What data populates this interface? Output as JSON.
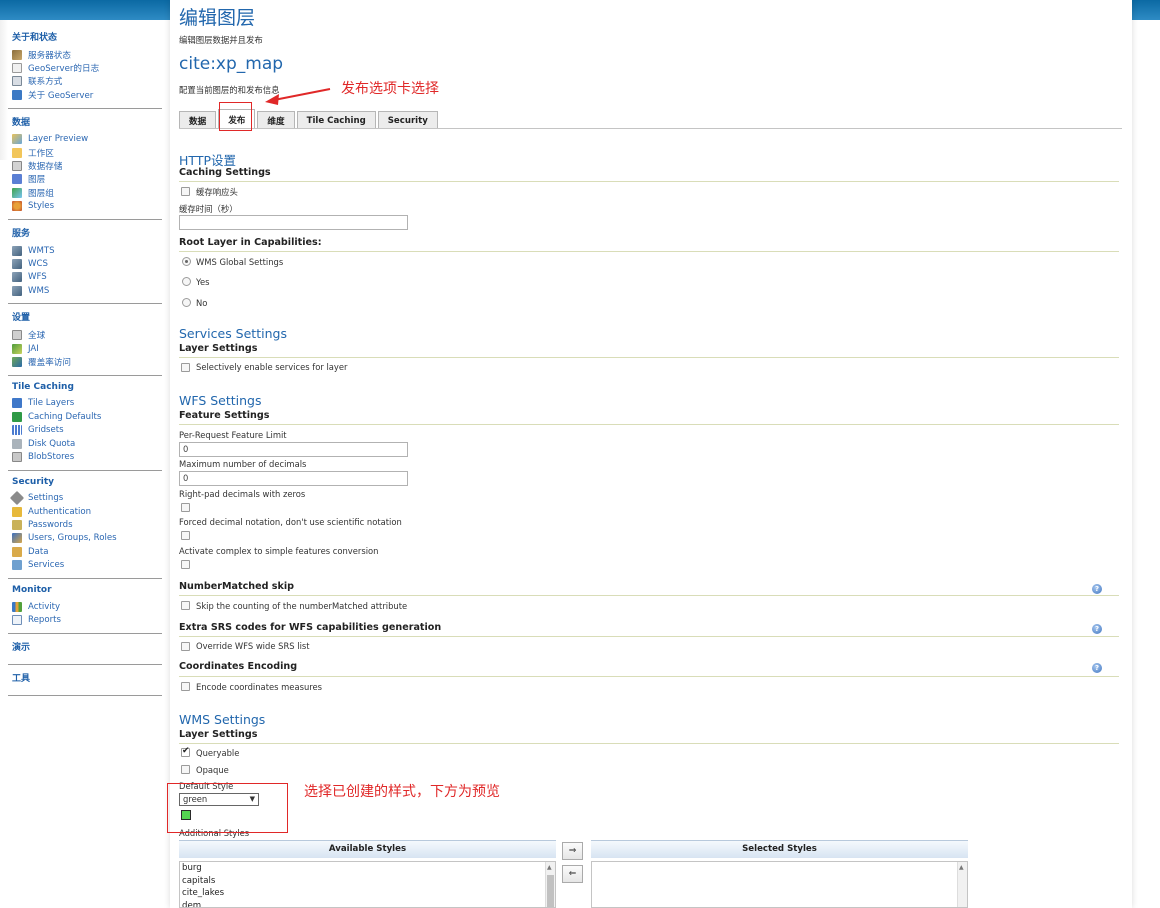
{
  "sidebar": {
    "sections": [
      {
        "title": "关于和状态",
        "items": [
          {
            "label": "服务器状态",
            "icon": "people-icon"
          },
          {
            "label": "GeoServer的日志",
            "icon": "doc-icon"
          },
          {
            "label": "联系方式",
            "icon": "card-icon"
          },
          {
            "label": "关于 GeoServer",
            "icon": "info-icon"
          }
        ]
      },
      {
        "title": "数据",
        "items": [
          {
            "label": "Layer Preview",
            "icon": "layer-preview-icon"
          },
          {
            "label": "工作区",
            "icon": "folder-icon"
          },
          {
            "label": "数据存储",
            "icon": "database-icon"
          },
          {
            "label": "图层",
            "icon": "layer-icon"
          },
          {
            "label": "图层组",
            "icon": "layergroup-icon"
          },
          {
            "label": "Styles",
            "icon": "styles-icon"
          }
        ]
      },
      {
        "title": "服务",
        "items": [
          {
            "label": "WMTS",
            "icon": "service-icon"
          },
          {
            "label": "WCS",
            "icon": "service-icon"
          },
          {
            "label": "WFS",
            "icon": "service-icon"
          },
          {
            "label": "WMS",
            "icon": "service-icon"
          }
        ]
      },
      {
        "title": "设置",
        "items": [
          {
            "label": "全球",
            "icon": "global-icon"
          },
          {
            "label": "JAI",
            "icon": "jai-icon"
          },
          {
            "label": "覆盖率访问",
            "icon": "coverage-icon"
          }
        ]
      },
      {
        "title": "Tile Caching",
        "items": [
          {
            "label": "Tile Layers",
            "icon": "tile-layers-icon"
          },
          {
            "label": "Caching Defaults",
            "icon": "caching-defaults-icon"
          },
          {
            "label": "Gridsets",
            "icon": "gridsets-icon"
          },
          {
            "label": "Disk Quota",
            "icon": "disk-quota-icon"
          },
          {
            "label": "BlobStores",
            "icon": "blobstores-icon"
          }
        ]
      },
      {
        "title": "Security",
        "items": [
          {
            "label": "Settings",
            "icon": "settings-icon"
          },
          {
            "label": "Authentication",
            "icon": "authentication-icon"
          },
          {
            "label": "Passwords",
            "icon": "passwords-icon"
          },
          {
            "label": "Users, Groups, Roles",
            "icon": "users-icon"
          },
          {
            "label": "Data",
            "icon": "data-icon"
          },
          {
            "label": "Services",
            "icon": "services-icon"
          }
        ]
      },
      {
        "title": "Monitor",
        "items": [
          {
            "label": "Activity",
            "icon": "activity-icon"
          },
          {
            "label": "Reports",
            "icon": "reports-icon"
          }
        ]
      },
      {
        "title": "演示",
        "items": []
      },
      {
        "title": "工具",
        "items": []
      }
    ]
  },
  "header": {
    "title": "编辑图层",
    "subtitle": "编辑图层数据并且发布",
    "layer_name": "cite:xp_map",
    "layer_subtitle": "配置当前图层的和发布信息"
  },
  "tabs": [
    "数据",
    "发布",
    "维度",
    "Tile Caching",
    "Security"
  ],
  "active_tab": "发布",
  "annotations": {
    "tab_note": "发布选项卡选择",
    "style_note": "选择已创建的样式，下方为预览"
  },
  "http": {
    "heading": "HTTP设置",
    "caching_heading": "Caching Settings",
    "cache_headers_label": "缓存响应头",
    "cache_time_label": "缓存时间（秒）",
    "cache_time_value": "",
    "root_layer_heading": "Root Layer in Capabilities:",
    "root_options": [
      "WMS Global Settings",
      "Yes",
      "No"
    ],
    "root_selected": "WMS Global Settings"
  },
  "services": {
    "heading": "Services Settings",
    "layer_settings_heading": "Layer Settings",
    "selective_label": "Selectively enable services for layer"
  },
  "wfs": {
    "heading": "WFS Settings",
    "feature_heading": "Feature Settings",
    "feature_limit_label": "Per-Request Feature Limit",
    "feature_limit_value": "0",
    "max_decimals_label": "Maximum number of decimals",
    "max_decimals_value": "0",
    "right_pad_label": "Right-pad decimals with zeros",
    "forced_decimal_label": "Forced decimal notation, don't use scientific notation",
    "complex_label": "Activate complex to simple features conversion",
    "number_matched_heading": "NumberMatched skip",
    "number_matched_label": "Skip the counting of the numberMatched attribute",
    "extra_srs_heading": "Extra SRS codes for WFS capabilities generation",
    "extra_srs_label": "Override WFS wide SRS list",
    "coord_heading": "Coordinates Encoding",
    "coord_label": "Encode coordinates measures"
  },
  "wms": {
    "heading": "WMS Settings",
    "layer_settings_heading": "Layer Settings",
    "queryable_label": "Queryable",
    "queryable_checked": true,
    "opaque_label": "Opaque",
    "opaque_checked": false,
    "default_style_label": "Default Style",
    "default_style_value": "green",
    "preview_color": "#55d651",
    "additional_styles_label": "Additional Styles",
    "available_styles_header": "Available Styles",
    "selected_styles_header": "Selected Styles",
    "available_styles": [
      "burg",
      "capitals",
      "cite_lakes",
      "dem"
    ],
    "selected_styles": [],
    "move_right": "⇒",
    "move_left": "⇐"
  },
  "colors": {
    "accent_blue": "#2267ad",
    "annotation_red": "#e02828",
    "topbar_blue": "#0b69a3"
  }
}
